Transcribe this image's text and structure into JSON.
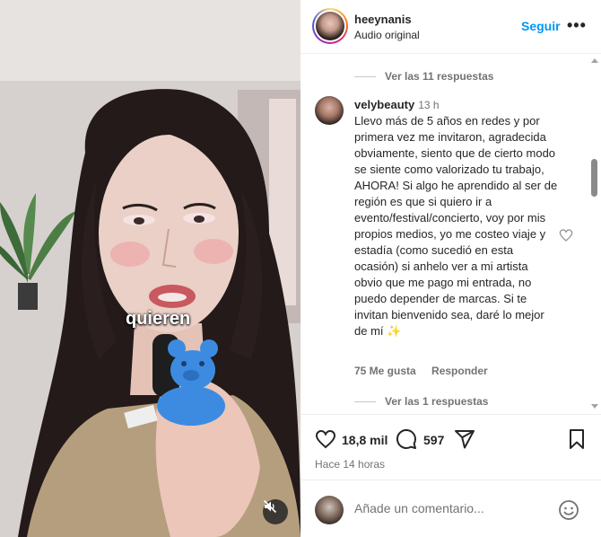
{
  "video": {
    "caption": "quieren"
  },
  "header": {
    "username": "heeynanis",
    "audio_label": "Audio original",
    "follow_label": "Seguir",
    "more_label": "•••"
  },
  "comments": {
    "replies_top_label": "Ver las 11 respuestas",
    "comment": {
      "username": "velybeauty",
      "time": "13 h",
      "text": "Llevo más de 5 años en redes y por primera vez me invitaron, agradecida obviamente, siento que de cierto modo se siente como valorizado tu trabajo, AHORA! Si algo he aprendido al ser de región es que si quiero ir a evento/festival/concierto, voy por mis propios medios, yo me costeo viaje y estadía (como sucedió en esta ocasión) si anhelo ver a mi artista obvio que me pago mi entrada, no puedo depender de marcas. Si te invitan bienvenido sea, daré lo mejor de mí ✨",
      "likes_label": "75 Me gusta",
      "reply_label": "Responder"
    },
    "replies_bottom_label": "Ver las 1 respuestas"
  },
  "actions": {
    "likes_count": "18,8 mil",
    "comments_count": "597",
    "posted_time": "Hace 14 horas"
  },
  "add_comment": {
    "placeholder": "Añade un comentario..."
  },
  "icons": {
    "like": "heart-icon",
    "comment": "comment-bubble-icon",
    "share": "paper-plane-icon",
    "save": "bookmark-icon",
    "mute": "speaker-muted-icon",
    "emoji": "smiley-icon"
  }
}
